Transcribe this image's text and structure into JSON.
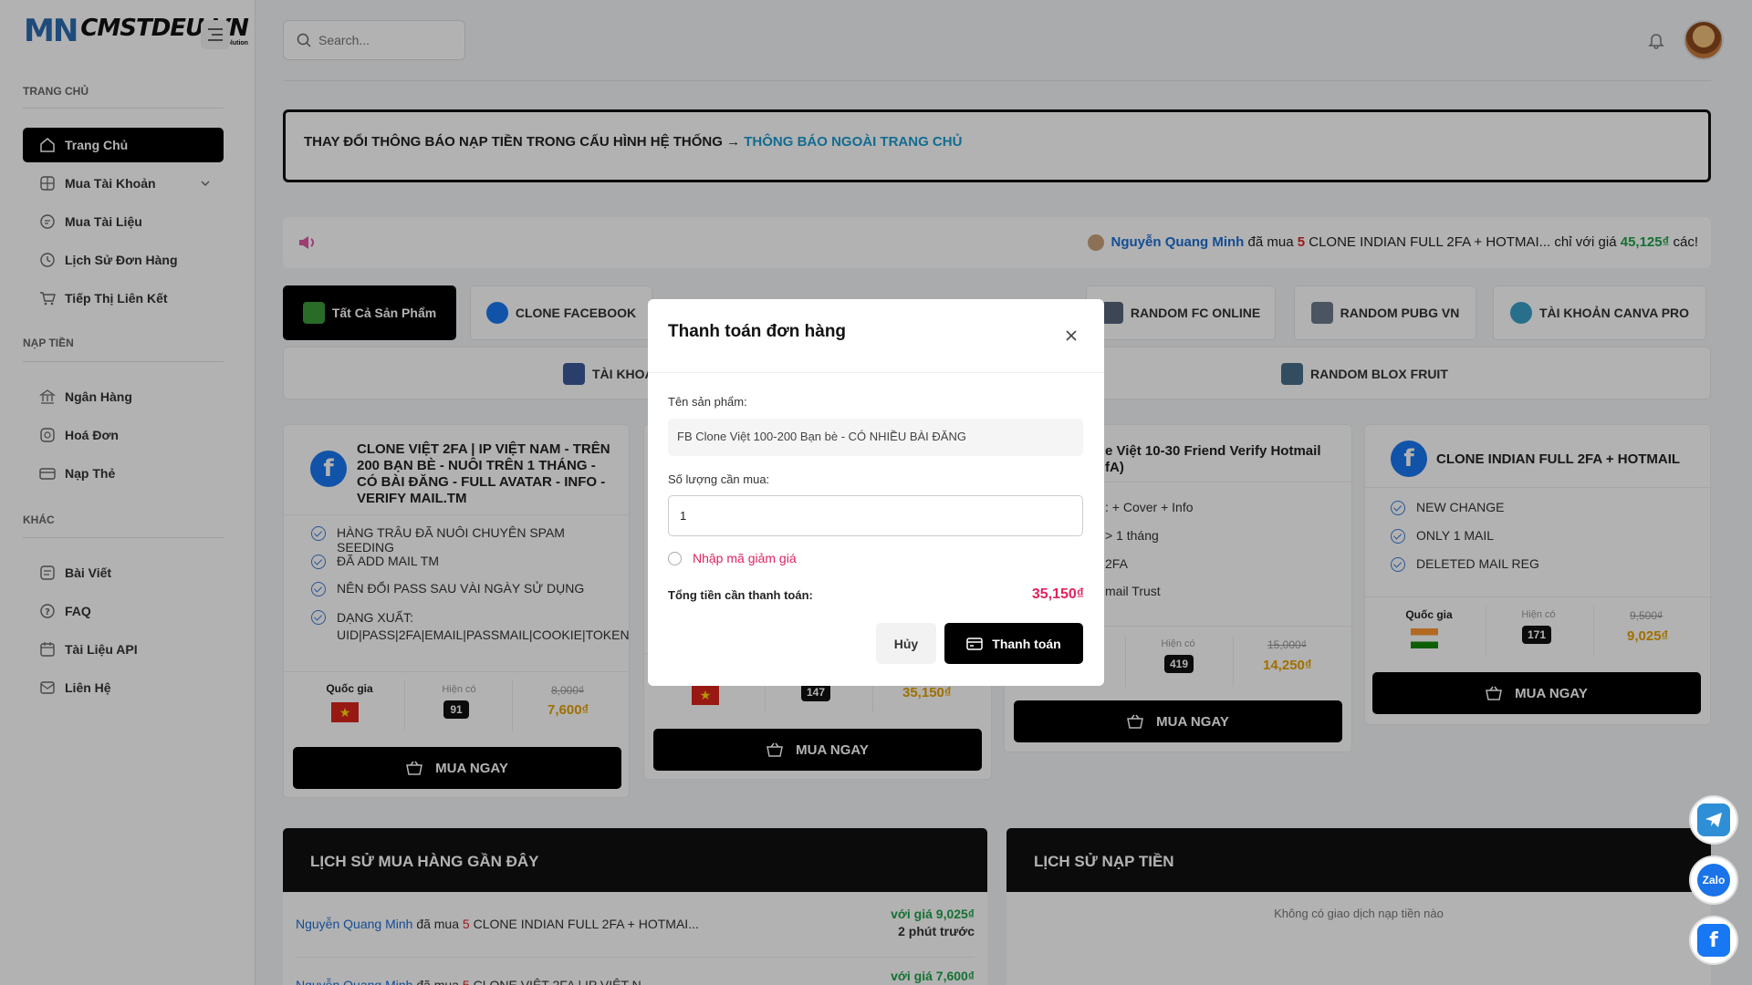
{
  "brand": {
    "mark": "MN",
    "name": "CMSTDEU.VN",
    "tagline": "MMO Solution"
  },
  "search": {
    "placeholder": "Search..."
  },
  "sidebar": {
    "sections": [
      "TRANG CHỦ",
      "NẠP TIỀN",
      "KHÁC"
    ],
    "items": [
      {
        "label": "Trang Chủ",
        "icon": "home-icon"
      },
      {
        "label": "Mua Tài Khoản",
        "icon": "grid-icon"
      },
      {
        "label": "Mua Tài Liệu",
        "icon": "document-icon"
      },
      {
        "label": "Lịch Sử Đơn Hàng",
        "icon": "clock-icon"
      },
      {
        "label": "Tiếp Thị Liên Kết",
        "icon": "cart-icon"
      },
      {
        "label": "Ngân Hàng",
        "icon": "bank-icon"
      },
      {
        "label": "Hoá Đơn",
        "icon": "receipt-icon"
      },
      {
        "label": "Nạp Thẻ",
        "icon": "card-icon"
      },
      {
        "label": "Bài Viết",
        "icon": "article-icon"
      },
      {
        "label": "FAQ",
        "icon": "question-icon"
      },
      {
        "label": "Tài Liệu API",
        "icon": "api-icon"
      },
      {
        "label": "Liên Hệ",
        "icon": "mail-icon"
      }
    ]
  },
  "notice": {
    "text": "THAY ĐỔI THÔNG BÁO NẠP TIỀN TRONG CẤU HÌNH HỆ THỐNG → ",
    "link": "THÔNG BÁO NGOÀI TRANG CHỦ"
  },
  "ticker": {
    "name": "Nguyễn Quang Minh",
    "bought": "đã mua",
    "qty": "5",
    "product": "CLONE INDIAN FULL 2FA + HOTMAI...",
    "price_prefix": "chỉ với giá",
    "price": "45,125₫",
    "suffix": "các!"
  },
  "tabs": [
    {
      "label": "Tất Cả Sản Phẩm"
    },
    {
      "label": "CLONE FACEBOOK"
    },
    {
      "label": "RANDOM FC ONLINE"
    },
    {
      "label": "RANDOM PUBG VN"
    },
    {
      "label": "TÀI KHOẢN CANVA PRO"
    },
    {
      "label": "TÀI KHOẢ"
    },
    {
      "label": "RANDOM BLOX FRUIT"
    }
  ],
  "products": [
    {
      "title": "CLONE VIỆT 2FA | IP VIỆT NAM - TRÊN 200 BẠN BÈ - NUÔI TRÊN 1 THÁNG - CÓ BÀI ĐĂNG - FULL AVATAR - INFO - VERIFY MAIL.TM",
      "features": [
        "HÀNG TRÂU ĐÃ NUÔI CHUYÊN SPAM SEEDING",
        "ĐÃ ADD MAIL TM",
        "NÊN ĐỔI PASS SAU VÀI NGÀY SỬ DỤNG",
        "DẠNG XUẤT: UID|PASS|2FA|EMAIL|PASSMAIL|COOKIE|TOKEN"
      ],
      "country_label": "Quốc gia",
      "stock_label": "Hiện có",
      "stock": "91",
      "old_price": "8,000₫",
      "price": "7,600₫",
      "buy": "MUA NGAY"
    },
    {
      "stock": "147",
      "price": "35,150₫",
      "buy": "MUA NGAY"
    },
    {
      "title_line1": "e Việt 10-30 Friend Verify Hotmail",
      "title_line2": "fA)",
      "features": [
        ": + Cover + Info",
        "> 1 tháng",
        "2FA",
        "mail Trust"
      ],
      "stock_label": "Hiện có",
      "stock": "419",
      "old_price": "15,000₫",
      "price": "14,250₫",
      "buy": "MUA NGAY"
    },
    {
      "title": "CLONE INDIAN FULL 2FA + HOTMAIL",
      "features": [
        "NEW CHANGE",
        "ONLY 1 MAIL",
        "DELETED MAIL REG"
      ],
      "country_label": "Quốc gia",
      "stock_label": "Hiện có",
      "stock": "171",
      "old_price": "9,500₫",
      "price": "9,025₫",
      "buy": "MUA NGAY"
    }
  ],
  "history": {
    "title": "LỊCH SỬ MUA HÀNG GẦN ĐÂY",
    "rows": [
      {
        "name": "Nguyễn Quang Minh",
        "bought": "đã mua",
        "qty": "5",
        "product": "CLONE INDIAN FULL 2FA + HOTMAI...",
        "price": "với giá 9,025₫",
        "time": "2 phút trước"
      },
      {
        "name": "Nguyễn Quang Minh",
        "bought": "đã mua",
        "qty": "5",
        "product": "CLONE VIỆT 2FA | IP VIỆT N...",
        "price": "với giá 7,600₫",
        "time": ""
      }
    ]
  },
  "deposits": {
    "title": "LỊCH SỬ NẠP TIỀN",
    "empty": "Không có giao dịch nạp tiền nào"
  },
  "modal": {
    "title": "Thanh toán đơn hàng",
    "product_label": "Tên sản phẩm:",
    "product_value": "FB Clone Việt 100-200 Bạn bè - CÓ NHIỀU BÀI ĐĂNG",
    "qty_label": "Số lượng cần mua:",
    "qty_value": "1",
    "coupon": "Nhập mã giảm giá",
    "total_label": "Tổng tiền cần thanh toán:",
    "total_value": "35,150₫",
    "cancel": "Hủy",
    "pay": "Thanh toán"
  },
  "floating": [
    "telegram-icon",
    "Zalo",
    "facebook-icon"
  ],
  "colors": {
    "accent": "#000000",
    "link": "#1a9bd0",
    "price": "#e6a100",
    "danger": "#e0245e"
  }
}
